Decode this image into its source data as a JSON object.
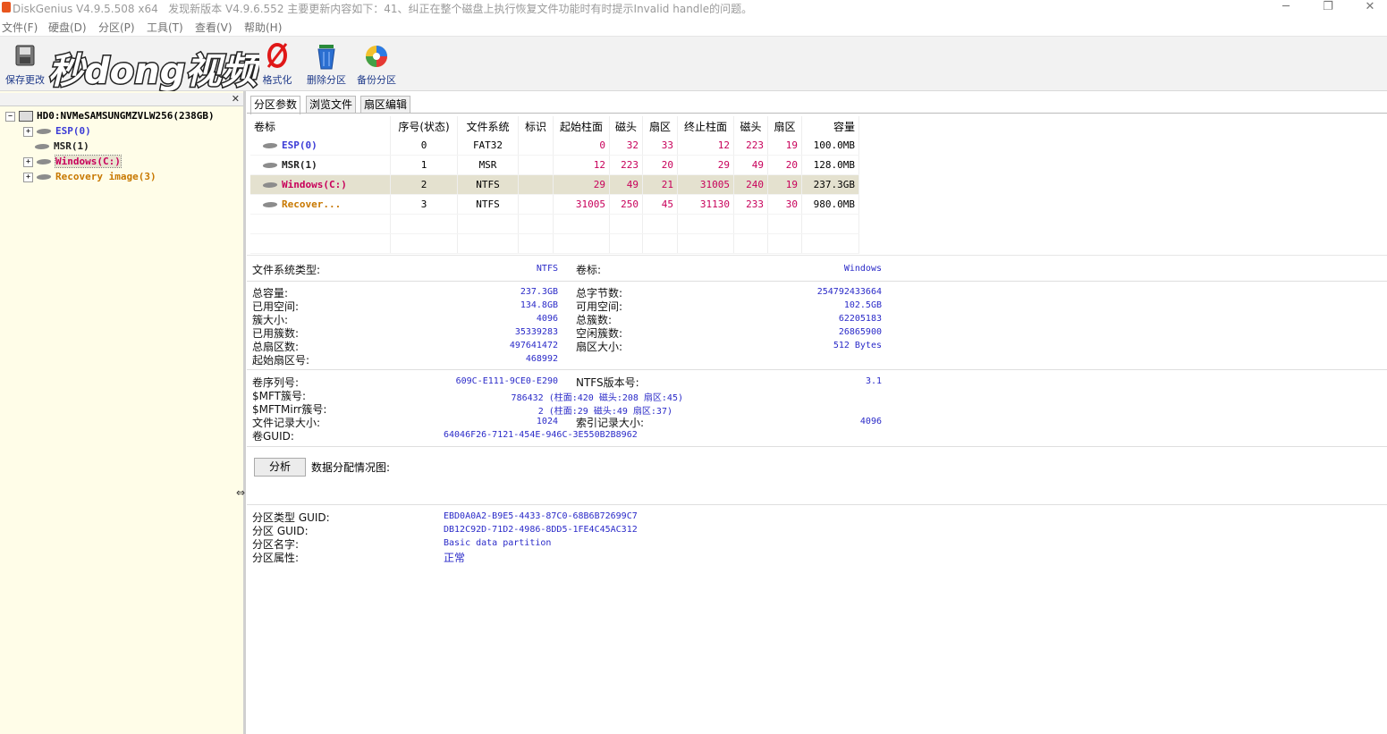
{
  "title": {
    "app": "DiskGenius V4.9.5.508 x64",
    "notice": "发现新版本 V4.9.6.552 主要更新内容如下：41、纠正在整个磁盘上执行恢复文件功能时有时提示Invalid handle的问题。"
  },
  "window_buttons": {
    "minimize": "─",
    "restore": "❐",
    "close": "✕"
  },
  "menu": [
    "文件(F)",
    "硬盘(D)",
    "分区(P)",
    "工具(T)",
    "查看(V)",
    "帮助(H)"
  ],
  "toolbar": {
    "save": "保存更改",
    "format": "格式化",
    "delete": "删除分区",
    "backup": "备份分区"
  },
  "watermark": "秒dong视频",
  "tree": {
    "disk": "HD0:NVMeSAMSUNGMZVLW256(238GB)",
    "partitions": [
      "ESP(0)",
      "MSR(1)",
      "Windows(C:)",
      "Recovery image(3)"
    ]
  },
  "tabs": [
    "分区参数",
    "浏览文件",
    "扇区编辑"
  ],
  "table": {
    "headers": [
      "卷标",
      "序号(状态)",
      "文件系统",
      "标识",
      "起始柱面",
      "磁头",
      "扇区",
      "终止柱面",
      "磁头",
      "扇区",
      "容量"
    ],
    "rows": [
      {
        "name": "ESP(0)",
        "idx": "0",
        "fs": "FAT32",
        "id": "",
        "sc": "0",
        "sh": "32",
        "ss": "33",
        "ec": "12",
        "eh": "223",
        "es": "19",
        "cap": "100.0MB"
      },
      {
        "name": "MSR(1)",
        "idx": "1",
        "fs": "MSR",
        "id": "",
        "sc": "12",
        "sh": "223",
        "ss": "20",
        "ec": "29",
        "eh": "49",
        "es": "20",
        "cap": "128.0MB"
      },
      {
        "name": "Windows(C:)",
        "idx": "2",
        "fs": "NTFS",
        "id": "",
        "sc": "29",
        "sh": "49",
        "ss": "21",
        "ec": "31005",
        "eh": "240",
        "es": "19",
        "cap": "237.3GB"
      },
      {
        "name": "Recover...",
        "idx": "3",
        "fs": "NTFS",
        "id": "",
        "sc": "31005",
        "sh": "250",
        "ss": "45",
        "ec": "31130",
        "eh": "233",
        "es": "30",
        "cap": "980.0MB"
      }
    ]
  },
  "info": {
    "fs_type_label": "文件系统类型:",
    "fs_type_value": "NTFS",
    "vol_label_label": "卷标:",
    "vol_label_value": "Windows",
    "total_cap_label": "总容量:",
    "total_cap_value": "237.3GB",
    "total_bytes_label": "总字节数:",
    "total_bytes_value": "254792433664",
    "used_label": "已用空间:",
    "used_value": "134.8GB",
    "free_label": "可用空间:",
    "free_value": "102.5GB",
    "cluster_size_label": "簇大小:",
    "cluster_size_value": "4096",
    "total_clusters_label": "总簇数:",
    "total_clusters_value": "62205183",
    "used_clusters_label": "已用簇数:",
    "used_clusters_value": "35339283",
    "free_clusters_label": "空闲簇数:",
    "free_clusters_value": "26865900",
    "total_sectors_label": "总扇区数:",
    "total_sectors_value": "497641472",
    "sector_size_label": "扇区大小:",
    "sector_size_value": "512 Bytes",
    "start_sector_label": "起始扇区号:",
    "start_sector_value": "468992",
    "serial_label": "卷序列号:",
    "serial_value": "609C-E111-9CE0-E290",
    "ntfs_ver_label": "NTFS版本号:",
    "ntfs_ver_value": "3.1",
    "mft_label": "$MFT簇号:",
    "mft_value": "786432 (柱面:420 磁头:208 扇区:45)",
    "mftmirr_label": "$MFTMirr簇号:",
    "mftmirr_value": "2 (柱面:29 磁头:49 扇区:37)",
    "record_size_label": "文件记录大小:",
    "record_size_value": "1024",
    "index_size_label": "索引记录大小:",
    "index_size_value": "4096",
    "guid_label": "卷GUID:",
    "guid_value": "64046F26-7121-454E-946C-3E550B2B8962"
  },
  "analyze": {
    "button": "分析",
    "label": "数据分配情况图:"
  },
  "guid": {
    "type_label": "分区类型 GUID:",
    "type_value": "EBD0A0A2-B9E5-4433-87C0-68B6B72699C7",
    "part_label": "分区 GUID:",
    "part_value": "DB12C92D-71D2-4986-8DD5-1FE4C45AC312",
    "name_label": "分区名字:",
    "name_value": "Basic data partition",
    "attr_label": "分区属性:",
    "attr_value": "正常"
  }
}
